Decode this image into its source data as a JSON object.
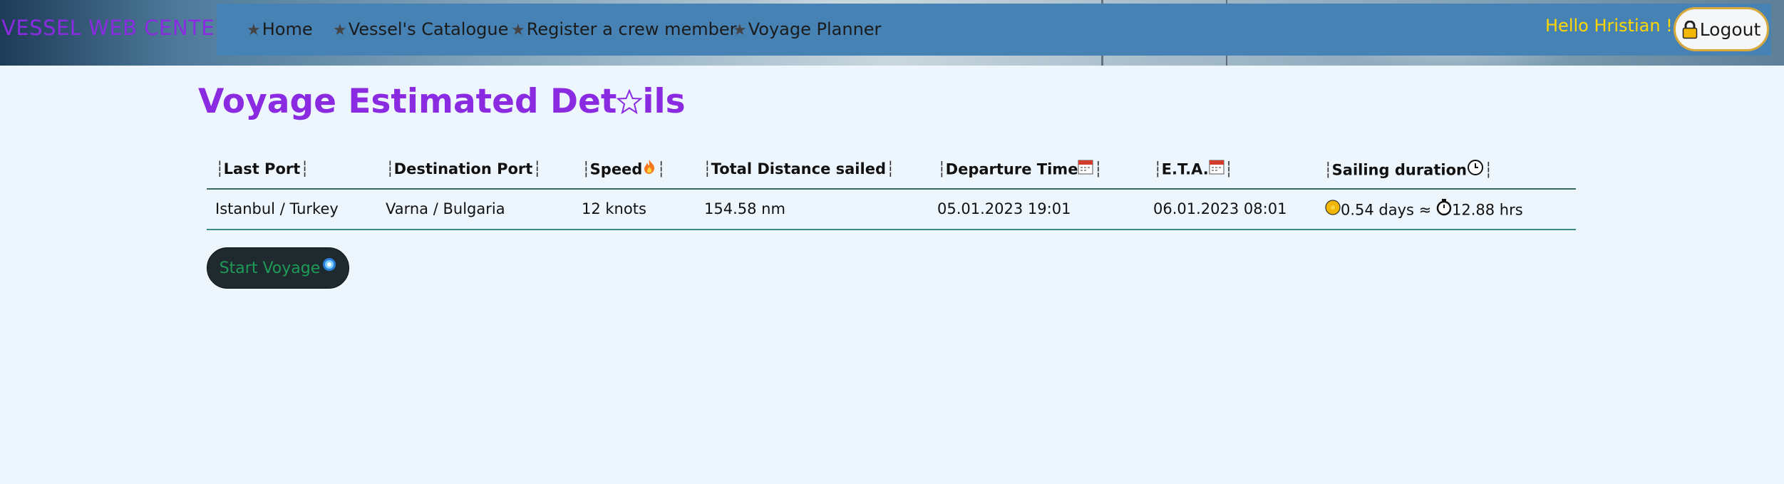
{
  "header": {
    "brand": "VESSEL WEB CENTER",
    "nav": [
      {
        "label": "Home"
      },
      {
        "label": "Vessel's Catalogue"
      },
      {
        "label": "Register a crew member"
      },
      {
        "label": "Voyage Planner"
      }
    ],
    "nav_icon": "star-icon",
    "greeting": "Hello Hristian !",
    "logout_label": "Logout",
    "logout_icon": "lock-icon"
  },
  "page": {
    "title_before": "Voyage Estimated Det",
    "title_icon": "star-outline-icon",
    "title_after": "ils"
  },
  "table": {
    "columns": [
      {
        "label": "Last Port",
        "icon": ""
      },
      {
        "label": "Destination Port",
        "icon": ""
      },
      {
        "label": "Speed",
        "icon": "fire-icon"
      },
      {
        "label": "Total Distance sailed",
        "icon": ""
      },
      {
        "label": "Departure Time",
        "icon": "calendar-icon"
      },
      {
        "label": "E.T.A.",
        "icon": "calendar-icon"
      },
      {
        "label": "Sailing duration",
        "icon": "clock-icon"
      }
    ],
    "rows": [
      {
        "last_port": "Istanbul / Turkey",
        "destination_port": "Varna / Bulgaria",
        "speed": "12 knots",
        "distance": "154.58 nm",
        "departure": "05.01.2023 19:01",
        "eta": "06.01.2023 08:01",
        "duration_days": "0.54 days ≈",
        "duration_hours": "12.88 hrs"
      }
    ]
  },
  "actions": {
    "start_label": "Start Voyage",
    "start_icon": "compass-icon"
  },
  "colors": {
    "brand": "#8a2be2",
    "navbar": "#4682b4",
    "greeting": "#ffd700",
    "start_text": "#1f9a57"
  }
}
